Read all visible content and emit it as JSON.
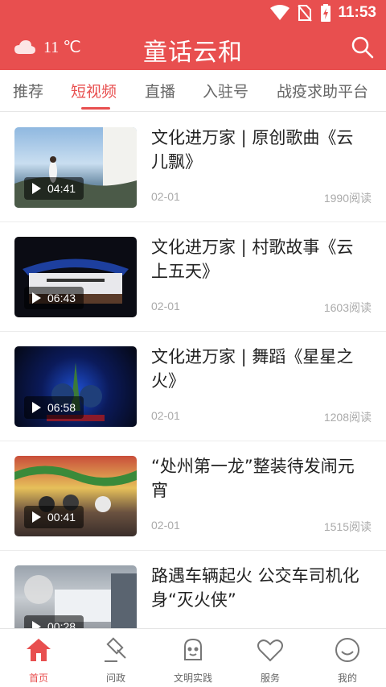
{
  "status_bar": {
    "time": "11:53"
  },
  "header": {
    "temperature": "11 ℃",
    "app_title": "童话云和",
    "weather_icon": "cloud-icon",
    "search_icon": "search-icon"
  },
  "tabs": [
    {
      "label": "推荐"
    },
    {
      "label": "短视频",
      "active": true
    },
    {
      "label": "直播"
    },
    {
      "label": "入驻号"
    },
    {
      "label": "战疫求助平台"
    }
  ],
  "videos": [
    {
      "title": "文化进万家 | 原创歌曲《云儿飘》",
      "duration": "04:41",
      "date": "02-01",
      "reads": "1990阅读"
    },
    {
      "title": "文化进万家 | 村歌故事《云上五天》",
      "duration": "06:43",
      "date": "02-01",
      "reads": "1603阅读"
    },
    {
      "title": "文化进万家 | 舞蹈《星星之火》",
      "duration": "06:58",
      "date": "02-01",
      "reads": "1208阅读"
    },
    {
      "title": "“处州第一龙”整装待发闹元宵",
      "duration": "00:41",
      "date": "02-01",
      "reads": "1515阅读"
    },
    {
      "title": "路遇车辆起火 公交车司机化身“灭火侠”",
      "duration": "00:28",
      "date": "",
      "reads": ""
    }
  ],
  "bottom_nav": [
    {
      "label": "首页",
      "icon": "home-icon",
      "active": true
    },
    {
      "label": "问政",
      "icon": "gavel-icon"
    },
    {
      "label": "文明实践",
      "icon": "mascot-icon"
    },
    {
      "label": "服务",
      "icon": "heart-icon"
    },
    {
      "label": "我的",
      "icon": "smiley-icon"
    }
  ],
  "colors": {
    "brand": "#e84f4f",
    "text": "#222222",
    "muted": "#aaaaaa"
  }
}
